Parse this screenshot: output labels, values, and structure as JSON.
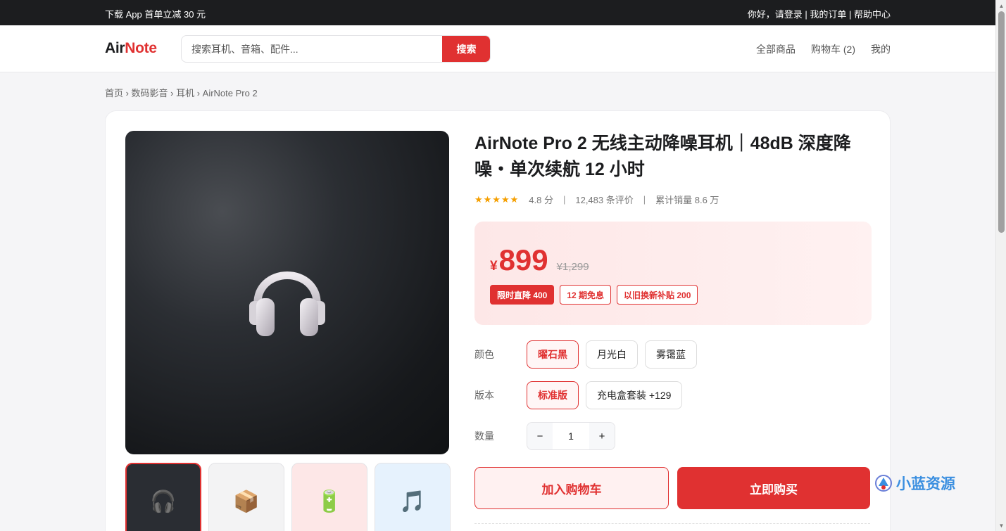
{
  "topbar": {
    "promo": "下载 App 首单立减 30 元",
    "links": "你好，请登录 | 我的订单 | 帮助中心"
  },
  "header": {
    "logo_part1": "Air",
    "logo_part2": "Note",
    "search_placeholder": "搜索耳机、音箱、配件...",
    "search_button": "搜索",
    "nav": [
      "全部商品",
      "购物车 (2)",
      "我的"
    ]
  },
  "breadcrumb": "首页 › 数码影音 › 耳机 › AirNote Pro 2",
  "product": {
    "title": "AirNote Pro 2 无线主动降噪耳机｜48dB 深度降噪・单次续航 12 小时",
    "stars": "★★★★★",
    "rating": "4.8 分",
    "reviews": "12,483 条评价",
    "sales": "累计销量 8.6 万",
    "currency": "¥",
    "price": "899",
    "original_price": "¥1,299",
    "tags": [
      "限时直降 400",
      "12 期免息",
      "以旧换新补贴 200"
    ],
    "color_label": "颜色",
    "colors": [
      "曜石黑",
      "月光白",
      "雾霭蓝"
    ],
    "version_label": "版本",
    "versions": [
      "标准版",
      "充电盒套装 +129"
    ],
    "qty_label": "数量",
    "qty_minus": "−",
    "qty_value": "1",
    "qty_plus": "+",
    "add_to_cart": "加入购物车",
    "buy_now": "立即购买"
  },
  "thumbnails": [
    {
      "icon": "headphones-icon",
      "glyph": "🎧"
    },
    {
      "icon": "package-icon",
      "glyph": "📦"
    },
    {
      "icon": "battery-icon",
      "glyph": "🔋"
    },
    {
      "icon": "music-note-icon",
      "glyph": "🎵"
    }
  ],
  "watermark": "小蓝资源",
  "colors": {
    "accent": "#e03131",
    "topbar": "#1c1d1f",
    "star": "#f59f00"
  }
}
